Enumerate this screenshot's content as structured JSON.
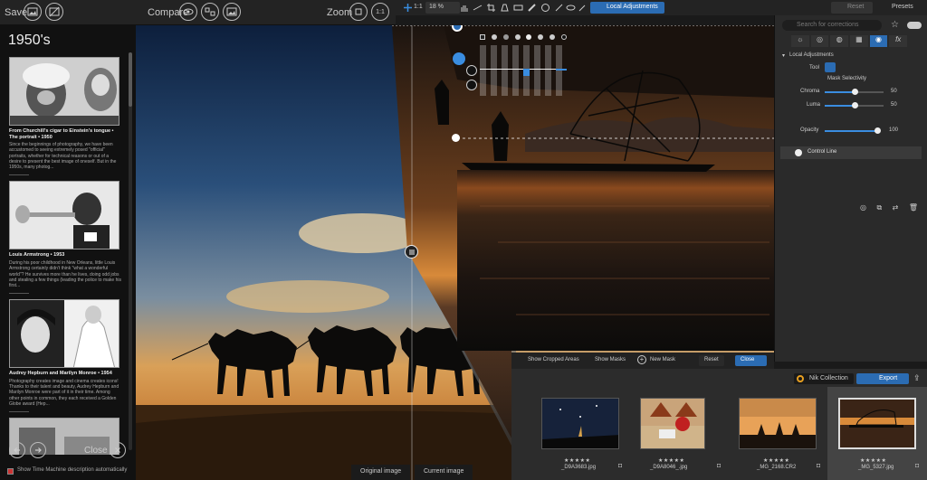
{
  "left_toolbar": {
    "save_label": "Save",
    "compare_label": "Compare",
    "zoom_label": "Zoom",
    "zoom_level": "1:1"
  },
  "sidebar": {
    "title": "1950's",
    "cards": [
      {
        "heading": "From Churchill's cigar to Einstein's tongue • The portrait • 1950",
        "body": "Since the beginnings of photography, we have been accustomed to seeing extremely posed \"official\" portraits, whether for technical reasons or out of a desire to present the best image of oneself. But in the 1950s, many photog..."
      },
      {
        "heading": "Louis Armstrong • 1953",
        "body": "During his poor childhood in New Orleans, little Louis Armstrong certainly didn't think \"what a wonderful world\"? He survives more than he lives, doing odd jobs and stealing a few things (leading the police to make his first..."
      },
      {
        "heading": "Audrey Hepburn and Marilyn Monroe • 1954",
        "body": "Photography creates image and cinema creates icons! Thanks to their talent and beauty, Audrey Hepburn and Marilyn Monroe were part of it in their time. Among other points in common, they each received a Golden Globe award (Hep..."
      }
    ],
    "close_label": "Close",
    "show_description_label": "Show Time Machine description automatically"
  },
  "image_toolbar": {
    "zoom_level": "1:1",
    "zoom_percent": "18 %",
    "local_adjustments_label": "Local Adjustments"
  },
  "right_panel": {
    "reset_label": "Reset",
    "presets_label": "Presets",
    "search_placeholder": "Search for corrections",
    "section_title": "Local Adjustments",
    "tool_label": "Tool",
    "mask_selectivity_label": "Mask Selectivity",
    "chroma_label": "Chroma",
    "chroma_value": "50",
    "chroma_fraction": 0.5,
    "luma_label": "Luma",
    "luma_value": "50",
    "luma_fraction": 0.5,
    "opacity_label": "Opacity",
    "opacity_value": "100",
    "opacity_fraction": 1.0,
    "control_line_label": "Control Line"
  },
  "bottom_bar": {
    "show_cropped_label": "Show Cropped Areas",
    "show_masks_label": "Show Masks",
    "new_mask_label": "New Mask",
    "reset_label": "Reset",
    "close_label": "Close"
  },
  "compare_labels": {
    "original": "Original image",
    "current": "Current image"
  },
  "filmstrip": {
    "nik_label": "Nik Collection",
    "export_label": "Export",
    "items": [
      {
        "name": "_D9A3683.jpg",
        "stars": "★★★★★"
      },
      {
        "name": "_D9A8046_.jpg",
        "stars": "★★★★★"
      },
      {
        "name": "_MG_2168.CR2",
        "stars": "★★★★★"
      },
      {
        "name": "_MG_5327.jpg",
        "stars": "★★★★★"
      }
    ]
  },
  "colors": {
    "accent_blue": "#2b6cb3",
    "panel_bg": "#2a2a2a",
    "toolbar_bg": "#232323"
  }
}
